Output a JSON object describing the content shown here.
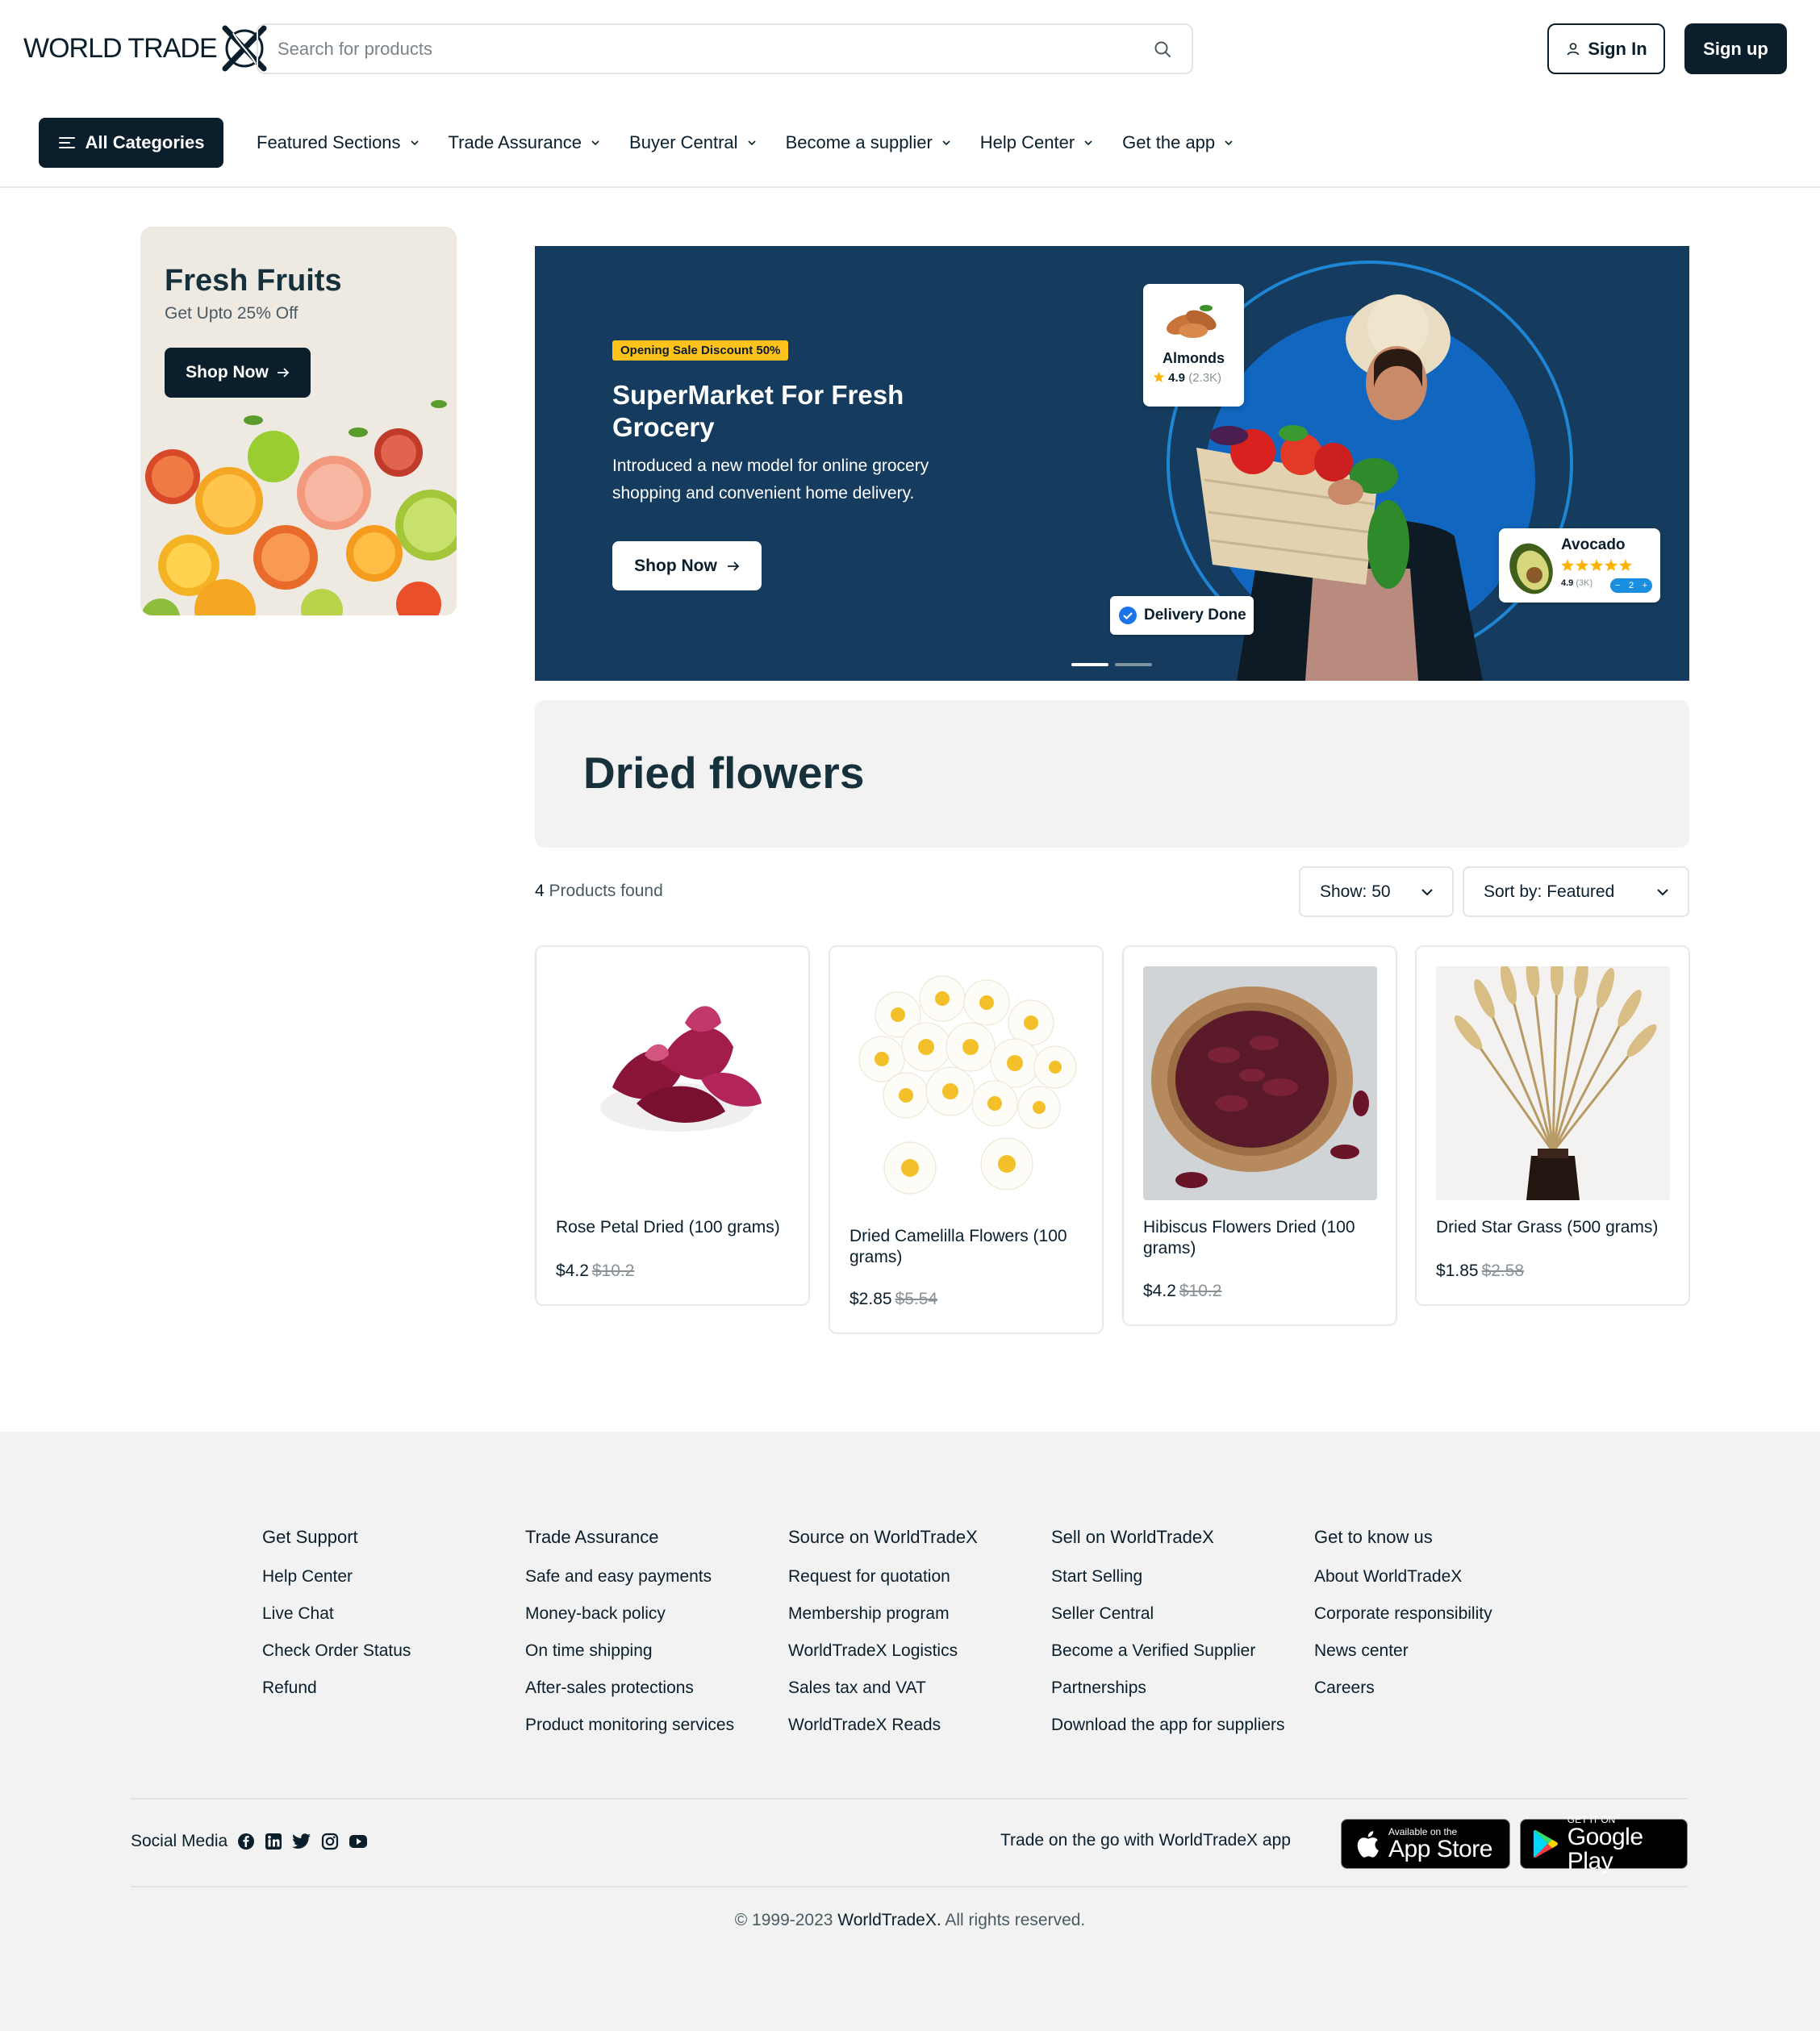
{
  "header": {
    "logo_text": "WORLD TRADE",
    "search_placeholder": "Search for products",
    "sign_in_label": "Sign In",
    "sign_up_label": "Sign up",
    "all_categories_label": "All Categories",
    "nav": [
      {
        "label": "Featured Sections"
      },
      {
        "label": "Trade Assurance"
      },
      {
        "label": "Buyer Central"
      },
      {
        "label": "Become a supplier"
      },
      {
        "label": "Help Center"
      },
      {
        "label": "Get the app"
      }
    ]
  },
  "promo": {
    "title": "Fresh Fruits",
    "subtitle": "Get Upto 25% Off",
    "button_label": "Shop Now"
  },
  "hero": {
    "badge": "Opening Sale Discount 50%",
    "title": "SuperMarket For Fresh Grocery",
    "description": "Introduced a new model for online grocery shopping and convenient home delivery.",
    "button_label": "Shop Now",
    "almond_card": {
      "name": "Almonds",
      "rating": "4.9",
      "count": "(2.3K)"
    },
    "avocado_card": {
      "name": "Avocado",
      "rating": "4.9",
      "count": "(3K)",
      "qty": "2"
    },
    "delivery_label": "Delivery Done"
  },
  "category": {
    "title": "Dried flowers",
    "count": "4",
    "found_label": "Products found",
    "show_label": "Show: 50",
    "sort_label": "Sort by: Featured"
  },
  "products": [
    {
      "name": "Rose Petal Dried (100 grams)",
      "price": "$4.2",
      "old_price": "$10.2"
    },
    {
      "name": "Dried Camelilla Flowers (100 grams)",
      "price": "$2.85",
      "old_price": "$5.54"
    },
    {
      "name": "Hibiscus Flowers Dried (100 grams)",
      "price": "$4.2",
      "old_price": "$10.2"
    },
    {
      "name": "Dried Star Grass (500 grams)",
      "price": "$1.85",
      "old_price": "$2.58"
    }
  ],
  "footer": {
    "columns": [
      {
        "title": "Get Support",
        "links": [
          "Help Center",
          "Live Chat",
          "Check Order Status",
          "Refund"
        ]
      },
      {
        "title": "Trade Assurance",
        "links": [
          "Safe and easy payments",
          "Money-back policy",
          "On time shipping",
          "After-sales protections",
          "Product monitoring services"
        ]
      },
      {
        "title": "Source on WorldTradeX",
        "links": [
          "Request for quotation",
          "Membership program",
          "WorldTradeX Logistics",
          "Sales tax and VAT",
          "WorldTradeX Reads"
        ]
      },
      {
        "title": "Sell on WorldTradeX",
        "links": [
          "Start Selling",
          "Seller Central",
          "Become a Verified Supplier",
          "Partnerships",
          "Download the app for suppliers"
        ]
      },
      {
        "title": "Get to know us",
        "links": [
          "About WorldTradeX",
          "Corporate responsibility",
          "News center",
          "Careers"
        ]
      }
    ],
    "social_label": "Social Media",
    "app_label": "Trade on the go with WorldTradeX app",
    "app_store": {
      "line1": "Available on the",
      "line2": "App Store"
    },
    "google_play": {
      "line1": "GET IT ON",
      "line2": "Google Play"
    },
    "copyright_prefix": "© 1999-2023",
    "copyright_brand": "WorldTradeX.",
    "copyright_suffix": "All rights reserved."
  },
  "colors": {
    "primary": "#0a1e2b",
    "hero_bg": "#153c5f",
    "badge": "#ffc21a",
    "footer_bg": "#f1f2f1"
  }
}
